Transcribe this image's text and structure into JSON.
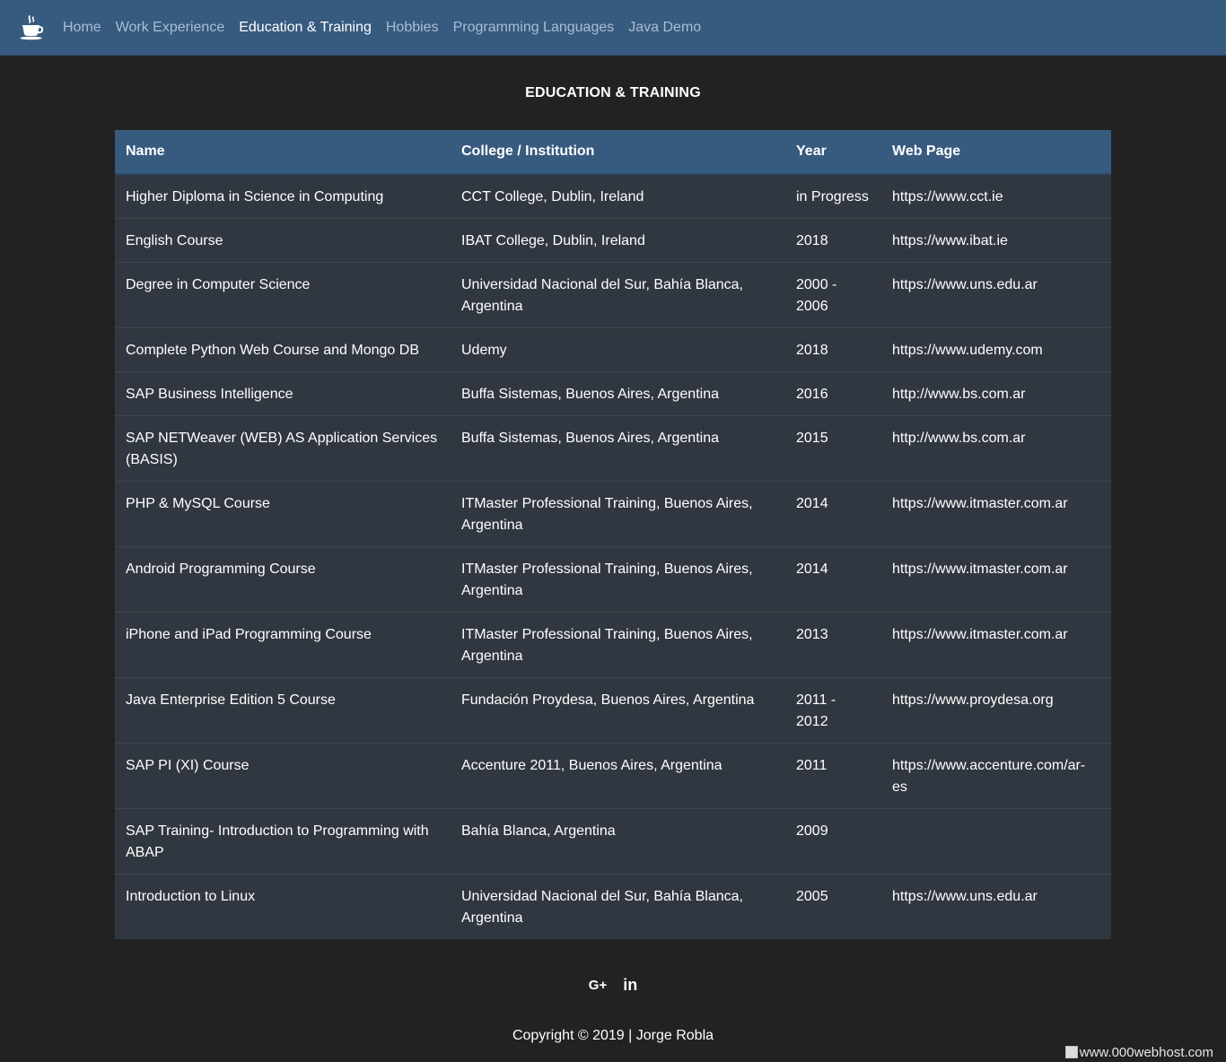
{
  "nav": {
    "logo_icon": "coffee-cup-icon",
    "items": [
      {
        "label": "Home",
        "active": false
      },
      {
        "label": "Work Experience",
        "active": false
      },
      {
        "label": "Education & Training",
        "active": true
      },
      {
        "label": "Hobbies",
        "active": false
      },
      {
        "label": "Programming Languages",
        "active": false
      },
      {
        "label": "Java Demo",
        "active": false
      }
    ]
  },
  "page": {
    "title": "EDUCATION & TRAINING"
  },
  "table": {
    "headers": [
      "Name",
      "College / Institution",
      "Year",
      "Web Page"
    ],
    "rows": [
      [
        "Higher Diploma in Science in Computing",
        "CCT College, Dublin, Ireland",
        "in Progress",
        "https://www.cct.ie"
      ],
      [
        "English Course",
        "IBAT College, Dublin, Ireland",
        "2018",
        "https://www.ibat.ie"
      ],
      [
        "Degree in Computer Science",
        "Universidad Nacional del Sur, Bahía Blanca, Argentina",
        "2000 - 2006",
        "https://www.uns.edu.ar"
      ],
      [
        "Complete Python Web Course and Mongo DB",
        "Udemy",
        "2018",
        "https://www.udemy.com"
      ],
      [
        "SAP Business Intelligence",
        "Buffa Sistemas, Buenos Aires, Argentina",
        "2016",
        "http://www.bs.com.ar"
      ],
      [
        "SAP NETWeaver (WEB) AS Application Services (BASIS)",
        "Buffa Sistemas, Buenos Aires, Argentina",
        "2015",
        "http://www.bs.com.ar"
      ],
      [
        "PHP & MySQL Course",
        "ITMaster Professional Training, Buenos Aires, Argentina",
        "2014",
        "https://www.itmaster.com.ar"
      ],
      [
        "Android Programming Course",
        "ITMaster Professional Training, Buenos Aires, Argentina",
        "2014",
        "https://www.itmaster.com.ar"
      ],
      [
        "iPhone and iPad Programming Course",
        "ITMaster Professional Training, Buenos Aires, Argentina",
        "2013",
        "https://www.itmaster.com.ar"
      ],
      [
        "Java Enterprise Edition 5 Course",
        "Fundación Proydesa, Buenos Aires, Argentina",
        "2011 - 2012",
        "https://www.proydesa.org"
      ],
      [
        "SAP PI (XI) Course",
        "Accenture 2011, Buenos Aires, Argentina",
        "2011",
        "https://www.accenture.com/ar-es"
      ],
      [
        "SAP Training- Introduction to Programming with ABAP",
        "Bahía Blanca, Argentina",
        "2009",
        ""
      ],
      [
        "Introduction to Linux",
        "Universidad Nacional del Sur, Bahía Blanca, Argentina",
        "2005",
        "https://www.uns.edu.ar"
      ]
    ]
  },
  "footer": {
    "social": [
      {
        "label": "G+",
        "icon": "google-plus-icon"
      },
      {
        "label": "in",
        "icon": "linkedin-icon"
      }
    ],
    "copyright": "Copyright © 2019 | Jorge Robla",
    "host_badge": "www.000webhost.com"
  },
  "colors": {
    "background": "#222222",
    "navbar": "#375a7f",
    "table_row": "#313740",
    "text": "#ffffff"
  }
}
